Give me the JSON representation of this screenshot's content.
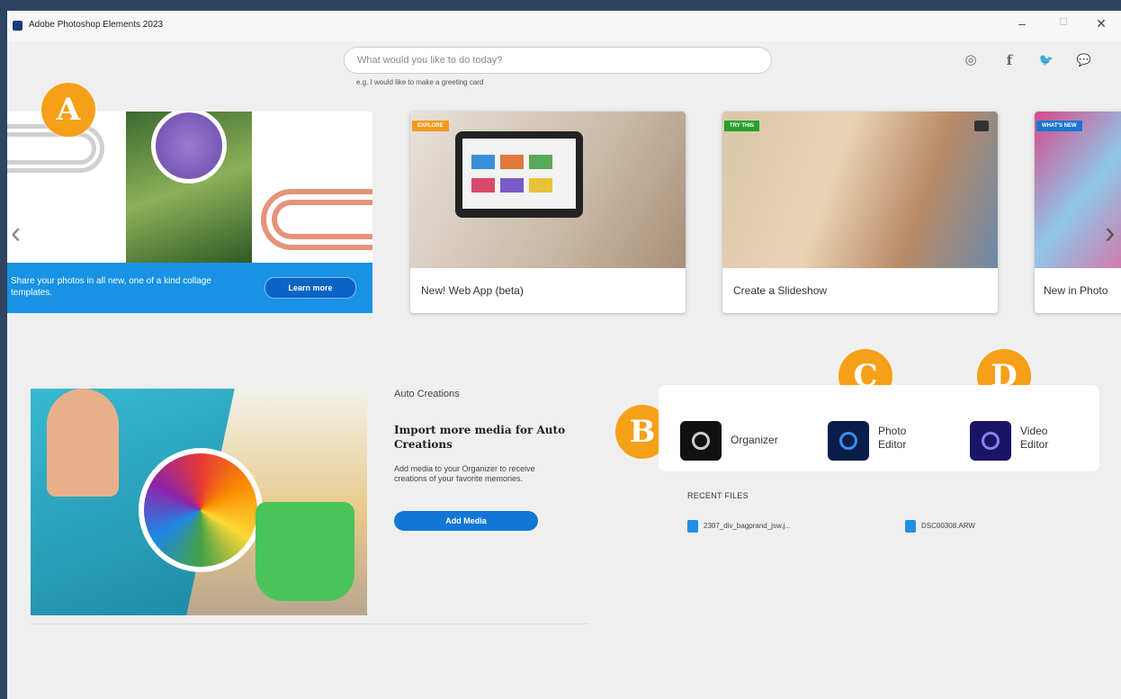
{
  "window": {
    "title": "Adobe Photoshop Elements 2023",
    "minimize": "–",
    "maximize": "☐",
    "close": "✕"
  },
  "search": {
    "placeholder": "What would you like to do today?",
    "hint": "e.g. I would like to make a greeting card"
  },
  "social": [
    {
      "icon": "instagram-icon",
      "glyph": "◎"
    },
    {
      "icon": "facebook-icon",
      "glyph": "f"
    },
    {
      "icon": "twitter-icon",
      "glyph": "🐦"
    },
    {
      "icon": "community-icon",
      "glyph": "💬"
    }
  ],
  "hero": {
    "text": "Share your photos in all new, one of a kind collage templates.",
    "button": "Learn more"
  },
  "cards": [
    {
      "tag": "EXPLORE",
      "tag_color": "#f39a1c",
      "label": "New! Web App (beta)"
    },
    {
      "tag": "TRY THIS",
      "tag_color": "#27a12d",
      "label": "Create a Slideshow"
    },
    {
      "tag": "WHAT'S NEW",
      "tag_color": "#1976d2",
      "label": "New in Photo"
    }
  ],
  "badges": {
    "a": "A",
    "b": "B",
    "c": "C",
    "d": "D"
  },
  "auto": {
    "title": "Auto Creations",
    "heading": "Import more media for Auto Creations",
    "desc": "Add media to your Organizer to receive creations of your favorite memories.",
    "button": "Add Media"
  },
  "launchers": {
    "organizer": "Organizer",
    "photo_editor_1": "Photo",
    "photo_editor_2": "Editor",
    "video_editor_1": "Video",
    "video_editor_2": "Editor"
  },
  "recent": {
    "title": "RECENT FILES",
    "files": [
      "2307_div_bagprand_jsw.j...",
      "DSC00308.ARW"
    ]
  },
  "colors": {
    "accent": "#1792e5",
    "badge": "#f5a017",
    "background": "#2d4560"
  }
}
